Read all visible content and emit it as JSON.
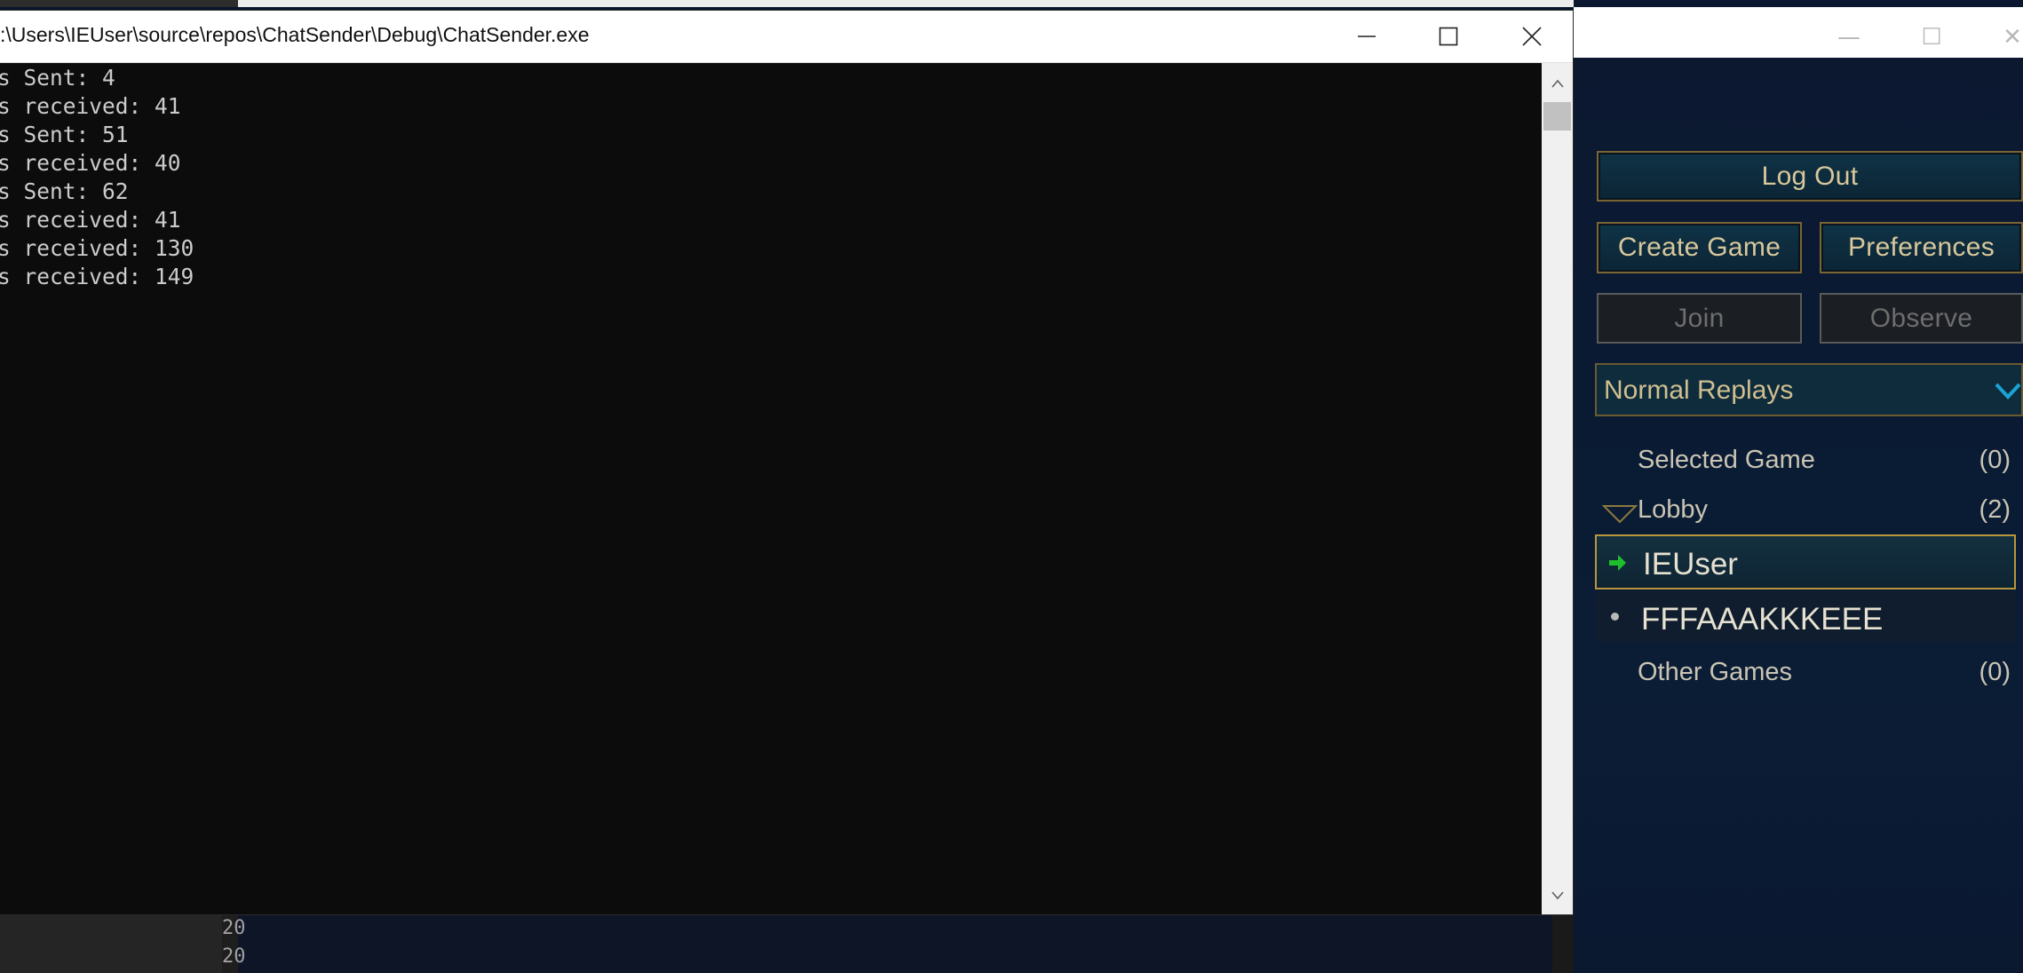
{
  "console": {
    "title": ":\\Users\\IEUser\\source\\repos\\ChatSender\\Debug\\ChatSender.exe",
    "lines": [
      "s Sent: 4",
      "s received: 41",
      "s Sent: 51",
      "s received: 40",
      "s Sent: 62",
      "s received: 41",
      "s received: 130",
      "s received: 149"
    ],
    "controls": {
      "minimize": "minimize-icon",
      "maximize": "maximize-icon",
      "close": "close-icon"
    }
  },
  "game": {
    "window_controls": {
      "minimize": "—",
      "maximize": "☐",
      "close": "✕"
    },
    "buttons": {
      "logout": "Log Out",
      "create_game": "Create Game",
      "preferences": "Preferences",
      "join": "Join",
      "observe": "Observe"
    },
    "dropdown": {
      "selected": "Normal Replays",
      "icon": "chevron-down-icon"
    },
    "groups": {
      "selected": {
        "name": "Selected Game",
        "count": "(0)"
      },
      "lobby": {
        "name": "Lobby",
        "count": "(2)"
      },
      "other": {
        "name": "Other Games",
        "count": "(0)"
      }
    },
    "players": [
      {
        "name": "IEUser",
        "status_icon": "green-arrow-icon"
      },
      {
        "name": "FFFAAAKKKEEE",
        "status_icon": "dot-icon"
      }
    ]
  },
  "bottom_strip": {
    "line_numbers": [
      "20",
      "20"
    ]
  },
  "colors": {
    "accent_gold": "#b8963e",
    "text_gold": "#d8c79b",
    "chevron_blue": "#1aa3d4",
    "arrow_green": "#1fbf2c",
    "console_bg": "#0c0c0c",
    "client_bg": "#0a1428"
  }
}
